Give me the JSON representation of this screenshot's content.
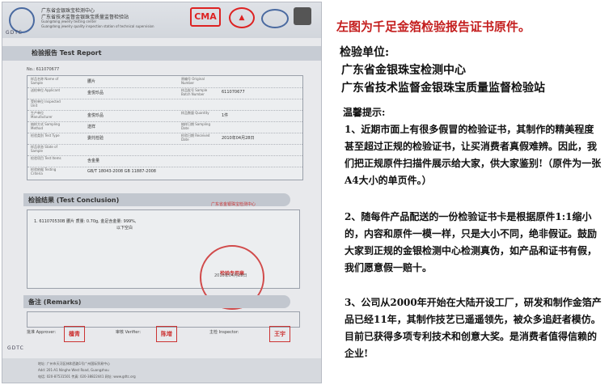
{
  "certificate": {
    "org_line1": "广东省金银珠宝检测中心",
    "org_line2": "广东省技术监督金银珠宝质量监督检验站",
    "org_line3": "Guangdong jewelry testing center",
    "org_line4": "Guangdong jewelry quality inspection station of technical supervision",
    "logo_text": "GDTC",
    "ma_mark": "CMA",
    "title": "检验报告 Test Report",
    "report_no": "No.: 611070677",
    "rows": [
      {
        "label": "样品名称 Name of Sample",
        "value": "腰片",
        "label_r": "原编号 Original Number",
        "value_r": ""
      },
      {
        "label": "送检单位 Applicant",
        "value": "金悦珍品",
        "label_r": "样品批号 Sample Batch Number",
        "value_r": "611070677"
      },
      {
        "label": "受检单位 Inspected Unit",
        "value": "",
        "label_r": "",
        "value_r": ""
      },
      {
        "label": "生产单位 Manufacturer",
        "value": "金悦珍品",
        "label_r": "样品数量 Quantity",
        "value_r": "1件"
      },
      {
        "label": "抽样方式 Sampling Method",
        "value": "送样",
        "label_r": "抽样日期 Sampling Date",
        "value_r": ""
      },
      {
        "label": "检验类别 Test Type",
        "value": "委托检验",
        "label_r": "检验日期 Received Date",
        "value_r": "2010年04月28日"
      },
      {
        "label": "样品状态 State of Sample",
        "value": "",
        "label_r": "",
        "value_r": ""
      },
      {
        "label": "检验项目 Test Items",
        "value": "含金量",
        "label_r": "",
        "value_r": ""
      },
      {
        "label": "检验依据 Testing Criteria",
        "value": "GB/T 18043-2008  GB 11887-2008",
        "label_r": "",
        "value_r": ""
      }
    ],
    "conclusion_title": "检验结果 (Test Conclusion)",
    "conclusion_line": "1. 611070530B    腰片      质量: 0.70g,  金足含金量: 999%,",
    "conclusion_line2": "以下空白",
    "seal_text": "广东省金银珠宝检测中心",
    "seal_sub": "检验专用章",
    "seal_date": "2010年04月28日",
    "remarks_title": "备注 (Remarks)",
    "sign_approver": "批准 Approver:",
    "sign_verifier": "审核 Verifier:",
    "sign_inspector": "主检 Inspector:",
    "stamp1": "檀青",
    "stamp2": "陈增",
    "stamp3": "王宇",
    "footer_logo": "GDTC",
    "footer1": "地址: 广州市天河区林和西路1号广州国际贸易中心",
    "footer2": "Add: 201-A1 Ninghe West Road, Guangzhou",
    "footer3": "电话: 020-87531501  传真: 020-38822441  网址: www.gdtc.org"
  },
  "right": {
    "headline": "左图为千足金箔检验报告证书原件。",
    "unit_label": "检验单位:",
    "unit_1": "广东省金银珠宝检测中心",
    "unit_2": "广东省技术监督金银珠宝质量监督检验站",
    "tips_label": "温馨提示:",
    "para_1": "1、近期市面上有很多假冒的检验证书，其制作的精美程度甚至超过正规的检验证书，让买消费者真假难辨。因此，我们把正规原件扫描件展示给大家，供大家鉴别!（原件为一张A4大小的单页件。）",
    "para_2": "2、随每件产品配送的一份检验证书卡是根据原件1:1缩小的，内容和原件一模一样，只是大小不同，绝非假证。鼓励大家到正规的金银检测中心检测真伪，如产品和证书有假，我们愿意假一赔十。",
    "para_3": "3、公司从2000年开始在大陆开设工厂，研发和制作金箔产品已经11年，其制作技艺已遥遥领先，被众多追赶者模仿。目前已获得多项专利技术和创意大奖。是消费者值得信赖的企业!"
  }
}
